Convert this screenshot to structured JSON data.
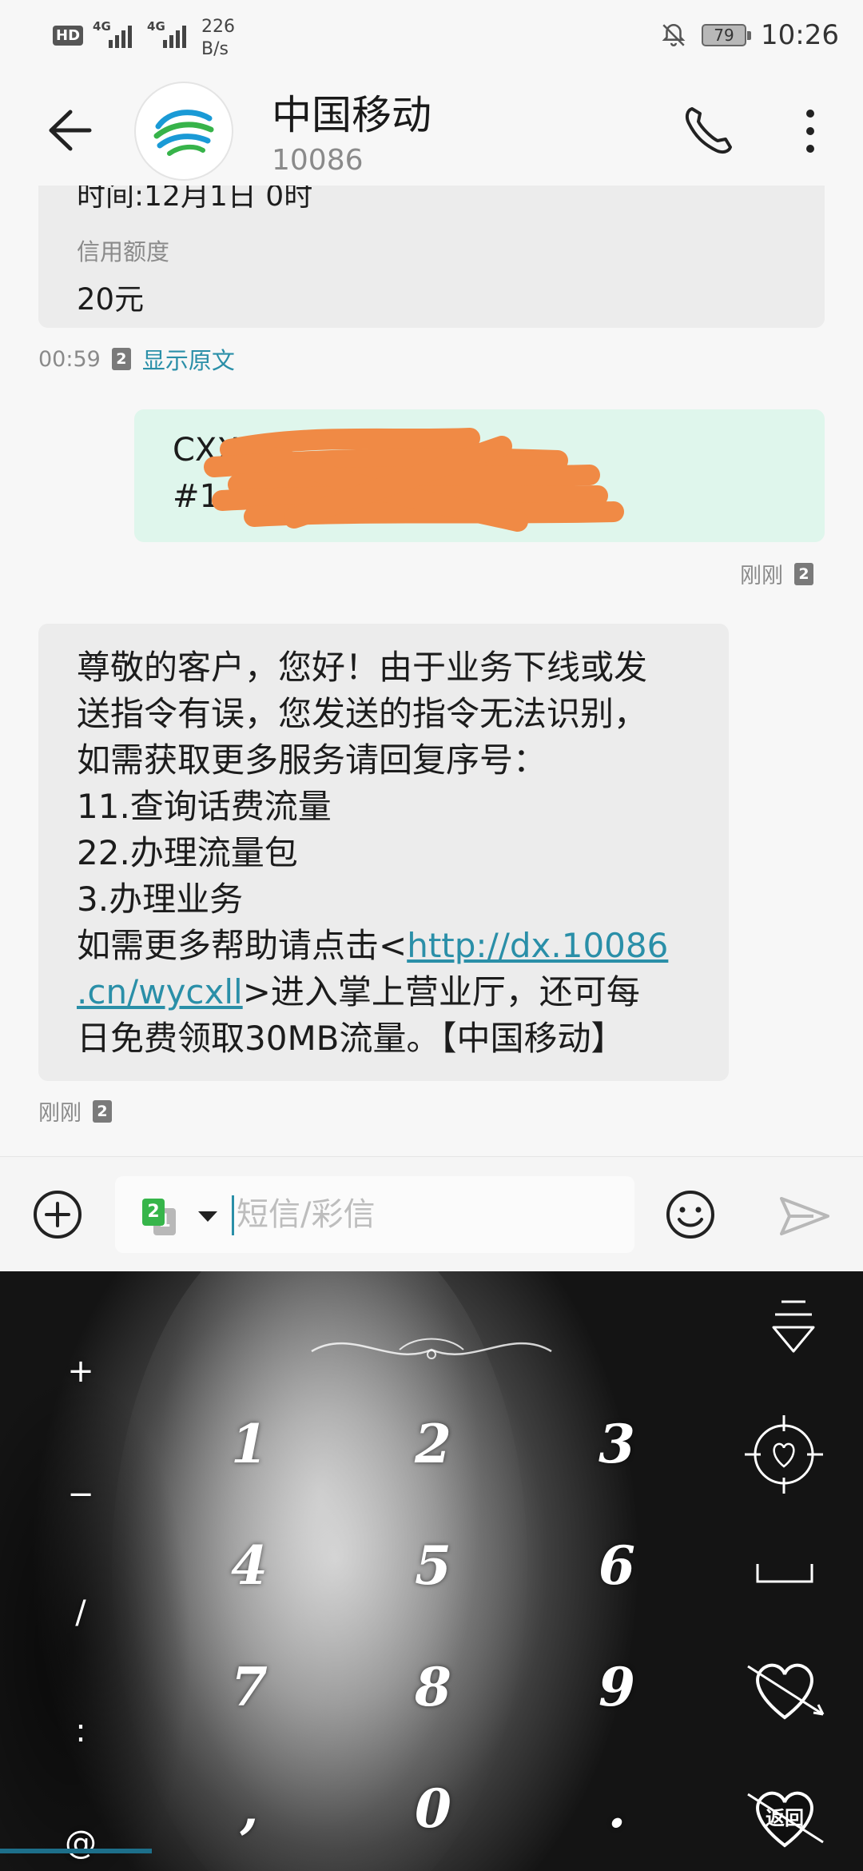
{
  "status_bar": {
    "hd": "HD",
    "net1": "4G",
    "net2": "4G",
    "speed_value": "226",
    "speed_unit": "B/s",
    "battery": "79",
    "time": "10:26"
  },
  "header": {
    "title": "中国移动",
    "subtitle": "10086",
    "back_icon": "back-arrow-icon",
    "call_icon": "phone-icon",
    "more_icon": "more-vertical-icon"
  },
  "messages": [
    {
      "direction": "incoming",
      "partial_line": "时间:12月1日 0时",
      "label": "信用额度",
      "value": "20元",
      "time": "00:59",
      "sim": "2",
      "action": "显示原文"
    },
    {
      "direction": "outgoing",
      "line1": "CXXZ#",
      "line2": "#1",
      "redacted": true,
      "time": "刚刚",
      "sim": "2"
    },
    {
      "direction": "incoming",
      "lines": [
        "尊敬的客户，您好！由于业务下线或发",
        "送指令有误，您发送的指令无法识别，",
        "如需获取更多服务请回复序号：",
        "11.查询话费流量",
        "22.办理流量包",
        "3.办理业务"
      ],
      "help_prefix": "如需更多帮助请点击<",
      "link_part1": "http://dx.10086",
      "link_part2": ".cn/wycxll",
      "after_link": ">进入掌上营业厅，还可每",
      "last_line": "日免费领取30MB流量。【中国移动】",
      "time": "刚刚",
      "sim": "2"
    }
  ],
  "composer": {
    "sim_primary": "2",
    "sim_secondary": "1",
    "placeholder": "短信/彩信"
  },
  "keyboard": {
    "digits": [
      "1",
      "2",
      "3",
      "4",
      "5",
      "6",
      "7",
      "8",
      "9",
      "0"
    ],
    "comma": ",",
    "dot": ".",
    "symbols": [
      "+",
      "−",
      "/",
      ":",
      "@"
    ],
    "return_label": "返回"
  },
  "colors": {
    "incoming_bubble": "#ececec",
    "outgoing_bubble": "#dff6ec",
    "link": "#2a8fa8",
    "redaction": "#f08a45",
    "sim_green": "#36b54a"
  }
}
